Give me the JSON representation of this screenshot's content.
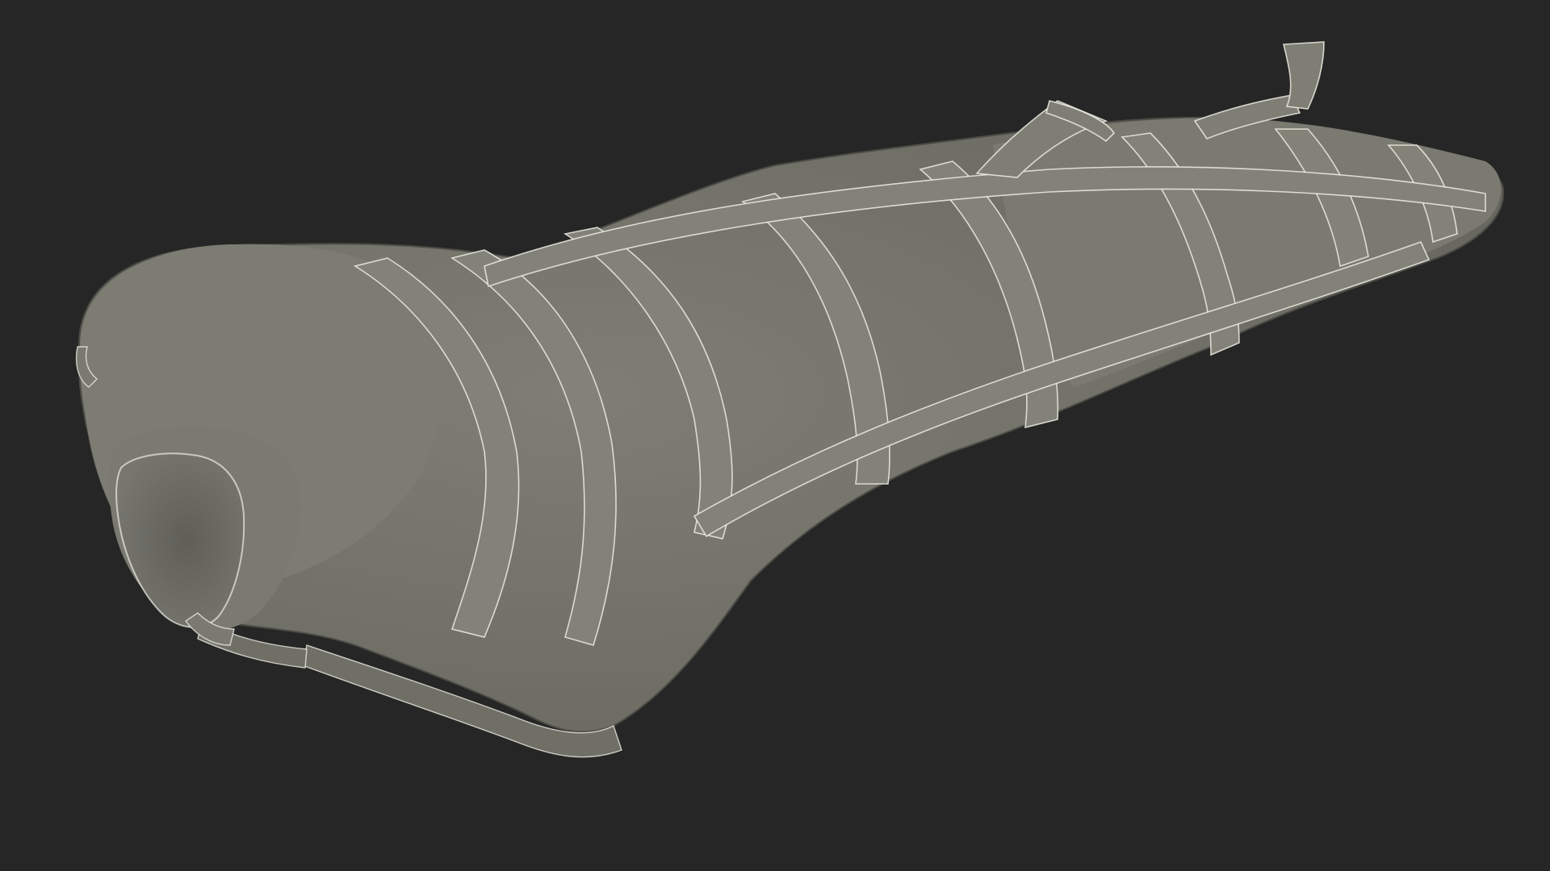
{
  "scene": {
    "background_color": "#262626",
    "mesh_fill_color": "#737369",
    "mesh_shadow_color": "#5b5b53",
    "mesh_highlight_color": "#86867c",
    "wire_color": "#ecece2",
    "strap_color": "#7d7d73",
    "render_mode": "wireframe-on-shaded",
    "subject": "wrapped-body-bag-mesh"
  }
}
